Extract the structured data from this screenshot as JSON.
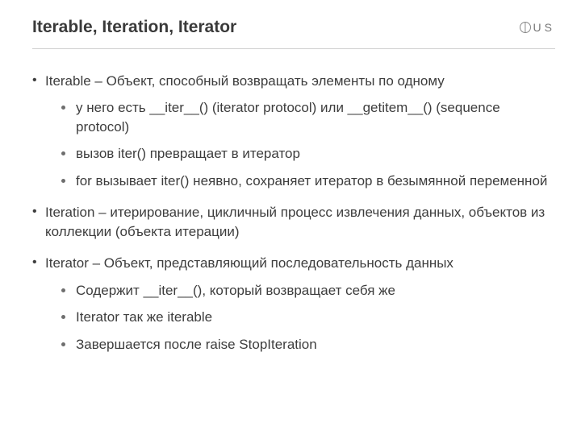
{
  "header": {
    "title": "Iterable, Iteration, Iterator",
    "logo_text": "US"
  },
  "bullets": [
    {
      "text": "Iterable – Объект, способный возвращать элементы по одному",
      "children": [
        "у него есть __iter__() (iterator protocol) или __getitem__() (sequence protocol)",
        "вызов iter() превращает в итератор",
        "for вызывает iter() неявно, сохраняет итератор в безымянной переменной"
      ]
    },
    {
      "text": "Iteration – итерирование, цикличный процесс извлечения данных, объектов из коллекции (объекта итерации)",
      "children": []
    },
    {
      "text": "Iterator – Объект, представляющий последовательность данных",
      "children": [
        "Содержит __iter__(), который возвращает себя же",
        "Iterator так же iterable",
        "Завершается после raise StopIteration"
      ]
    }
  ]
}
